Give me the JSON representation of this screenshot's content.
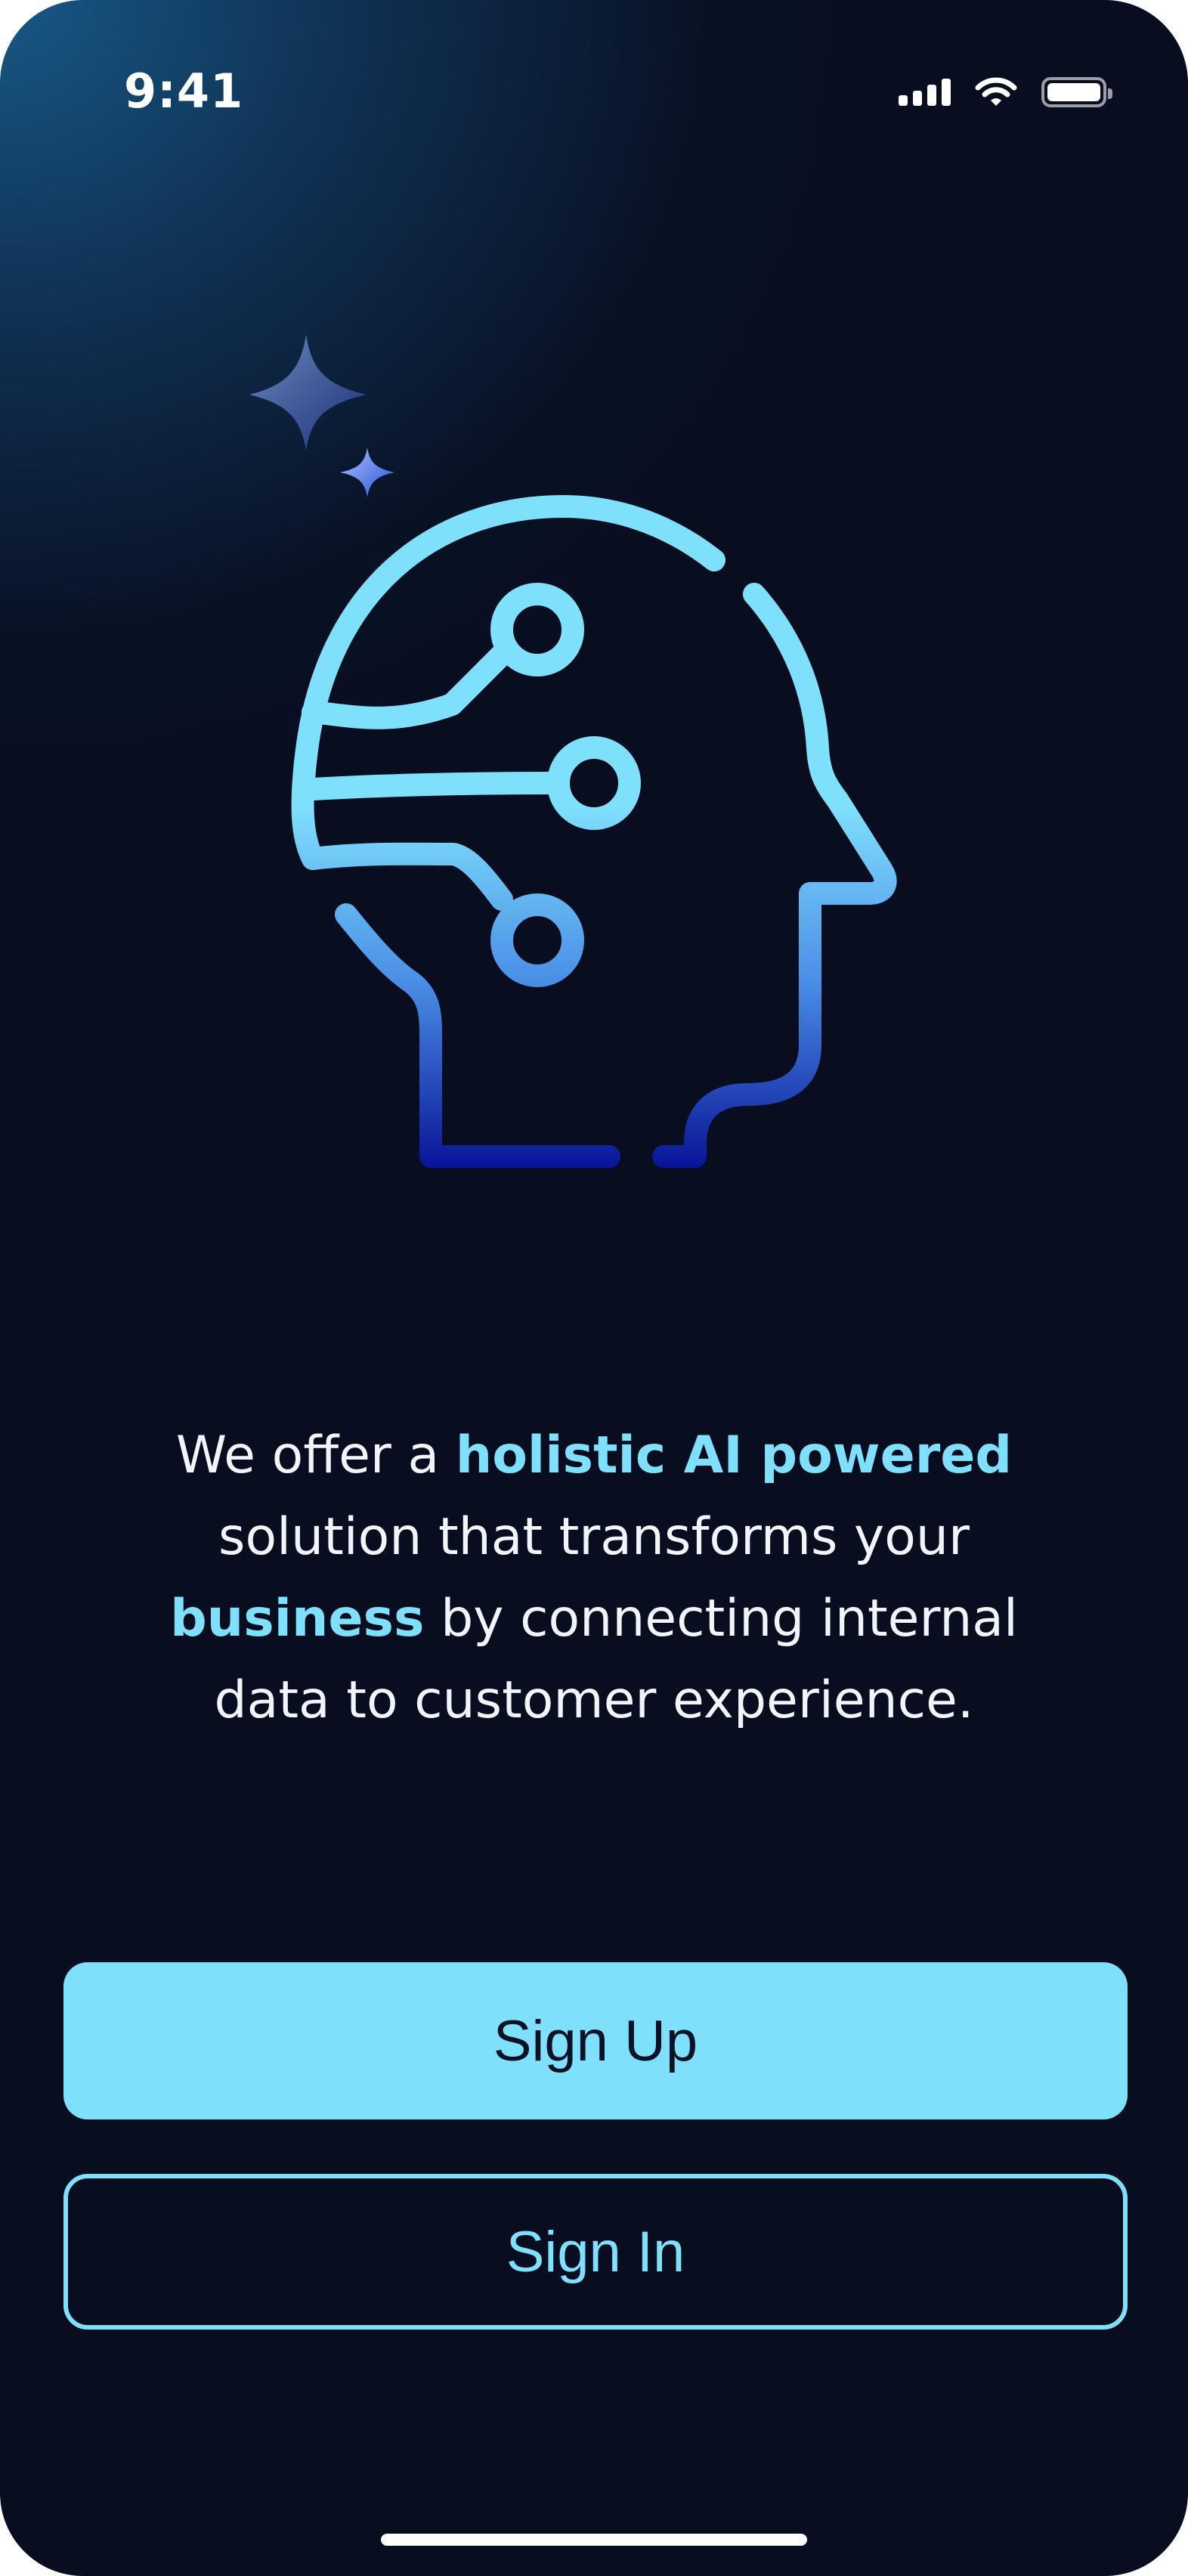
{
  "status_bar": {
    "time": "9:41",
    "icons": [
      "signal-icon",
      "wifi-icon",
      "battery-icon"
    ]
  },
  "illustration": {
    "icon": "ai-head-circuit-icon",
    "sparkles": [
      "sparkle-large-icon",
      "sparkle-small-icon"
    ],
    "colors": {
      "light_cyan": "#7fe0fc",
      "mid_blue": "#4a8ee6",
      "deep_blue": "#0a1699"
    }
  },
  "description": {
    "part1": "We offer a ",
    "highlight1": "holistic AI powered",
    "part2": " solution that transforms your ",
    "highlight2": "business",
    "part3": " by connecting internal data to customer experience."
  },
  "buttons": {
    "signup_label": "Sign Up",
    "signin_label": "Sign In"
  },
  "colors": {
    "background": "#080d1f",
    "accent": "#7fe0fc",
    "text": "#f1f4f8"
  }
}
